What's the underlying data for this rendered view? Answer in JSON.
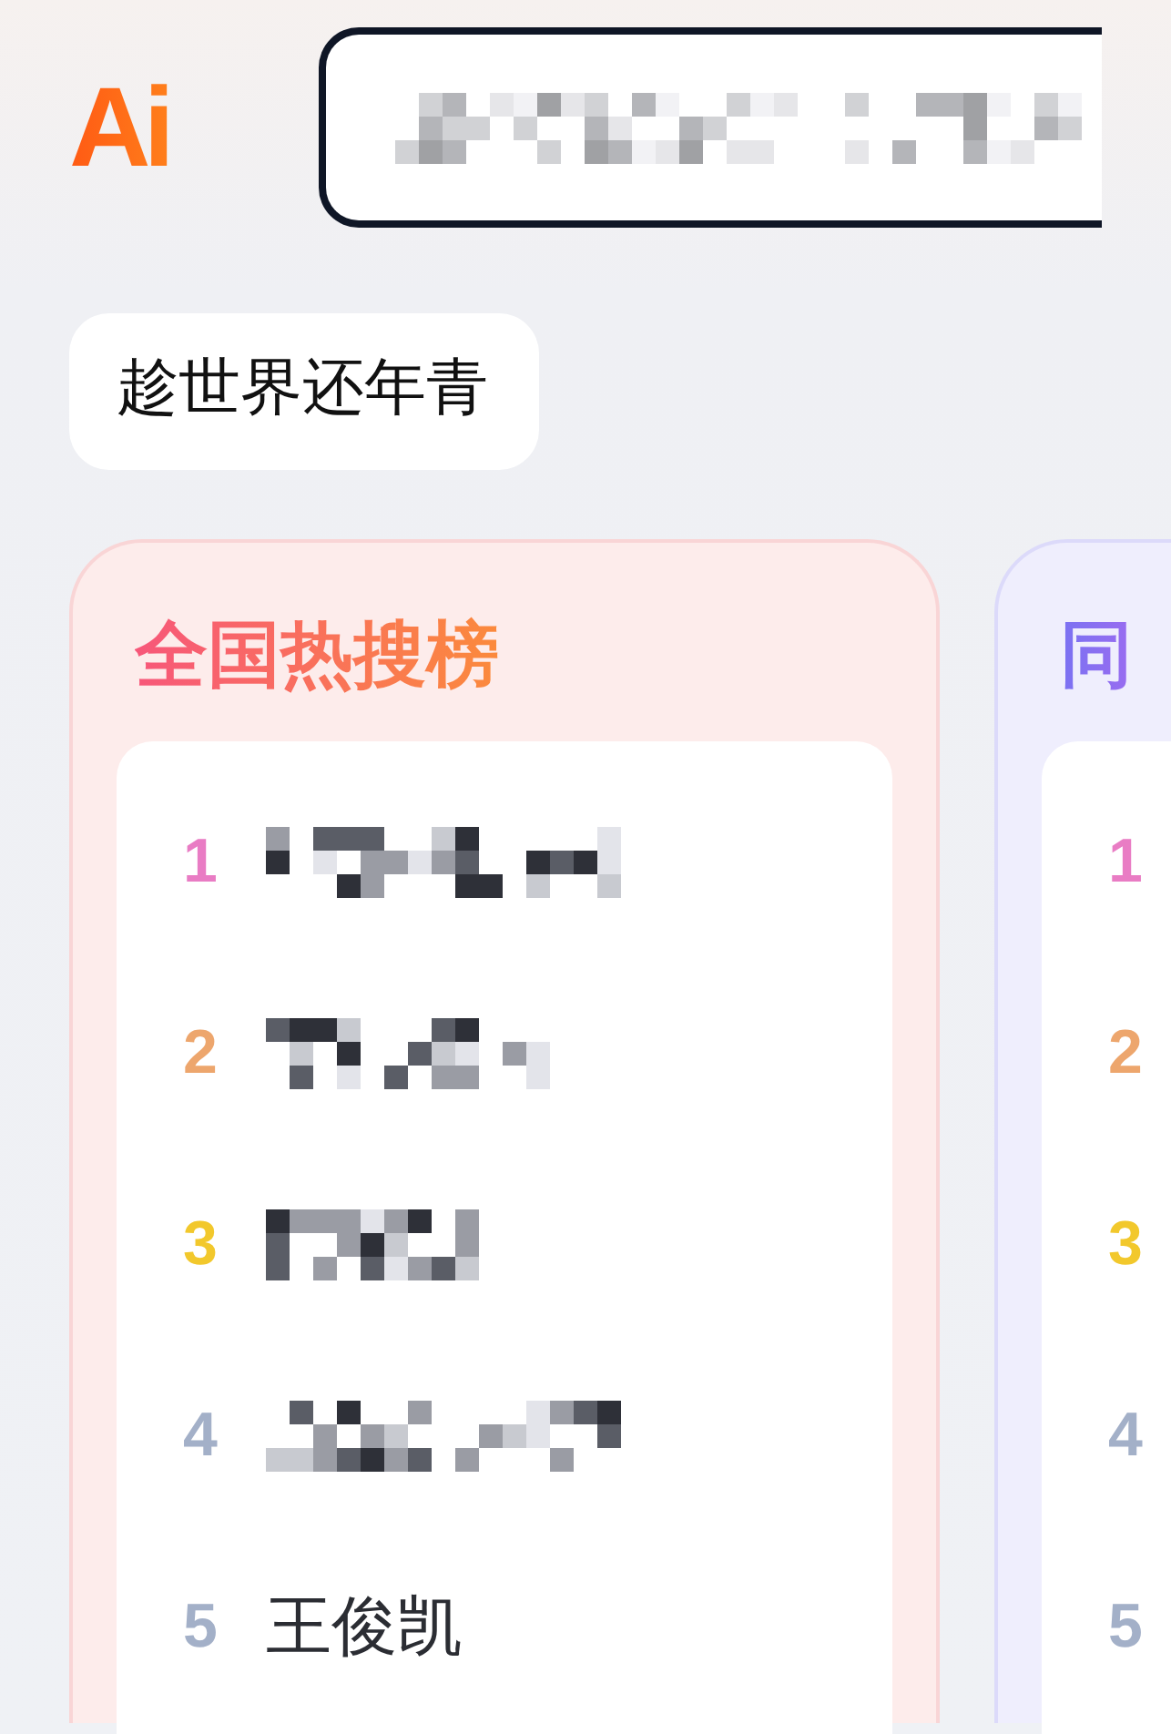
{
  "header": {
    "logo": "Ai",
    "search": {
      "kind": "redacted"
    }
  },
  "chip": "趁世界还年青",
  "panels": [
    {
      "title": "全国热搜榜",
      "kind": "hot",
      "items": [
        {
          "rank": "1",
          "color": "#e97cc4",
          "kind": "redacted"
        },
        {
          "rank": "2",
          "color": "#eda66d",
          "kind": "redacted"
        },
        {
          "rank": "3",
          "color": "#f2c82c",
          "kind": "redacted"
        },
        {
          "rank": "4",
          "color": "#a3b0c8",
          "kind": "redacted"
        },
        {
          "rank": "5",
          "color": "#a3b0c8",
          "kind": "text",
          "text": "王俊凯"
        }
      ]
    },
    {
      "title": "同",
      "kind": "local",
      "items": [
        {
          "rank": "1",
          "color": "#e97cc4",
          "kind": "empty"
        },
        {
          "rank": "2",
          "color": "#eda66d",
          "kind": "empty"
        },
        {
          "rank": "3",
          "color": "#f2c82c",
          "kind": "empty"
        },
        {
          "rank": "4",
          "color": "#a3b0c8",
          "kind": "empty"
        },
        {
          "rank": "5",
          "color": "#a3b0c8",
          "kind": "empty"
        }
      ]
    }
  ]
}
